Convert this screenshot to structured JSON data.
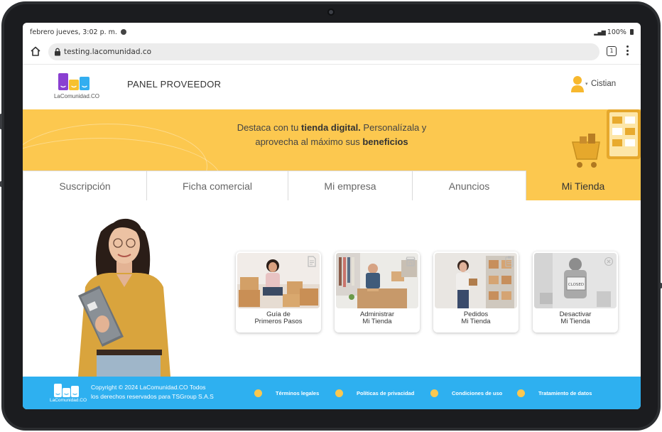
{
  "status_bar": {
    "time": "febrero jueves, 3:02 p. m.",
    "battery": "100%"
  },
  "browser": {
    "url": "testing.lacomunidad.co",
    "tab_count": "1"
  },
  "header": {
    "logo_text": "LaComunidad.CO",
    "panel_title": "PANEL PROVEEDOR",
    "user_name": "Cistian"
  },
  "banner": {
    "line1_prefix": "Destaca con tu ",
    "line1_bold": "tienda digital.",
    "line1_suffix": " Personalízala y",
    "line2_prefix": "aprovecha al máximo sus ",
    "line2_bold": "beneficios"
  },
  "tabs": [
    {
      "label": "Suscripción",
      "active": false
    },
    {
      "label": "Ficha comercial",
      "active": false
    },
    {
      "label": "Mi empresa",
      "active": false
    },
    {
      "label": "Anuncios",
      "active": false
    },
    {
      "label": "Mi Tienda",
      "active": true
    }
  ],
  "cards": [
    {
      "line1": "Guía de",
      "line2": "Primeros Pasos",
      "icon": "document-icon"
    },
    {
      "line1": "Administrar",
      "line2": "Mi Tienda",
      "icon": "storefront-icon"
    },
    {
      "line1": "Pedidos",
      "line2": "Mi Tienda",
      "icon": "clipboard-icon"
    },
    {
      "line1": "Desactivar",
      "line2": "Mi Tienda",
      "icon": "close-circle-icon"
    }
  ],
  "footer": {
    "logo_text": "LaComunidad.CO",
    "copyright_line1": "Copyright © 2024 LaComunidad.CO Todos",
    "copyright_line2": "los derechos reservados para TSGroup S.A.S",
    "links": [
      "Términos legales",
      "Políticas de privacidad",
      "Condiciones de uso",
      "Tratamiento de datos"
    ]
  },
  "colors": {
    "brand_yellow": "#fcc84f",
    "footer_blue": "#2eb0f0",
    "logo_purple": "#8a3fd1",
    "logo_yellow": "#f7c12e",
    "logo_blue": "#33aef0"
  }
}
